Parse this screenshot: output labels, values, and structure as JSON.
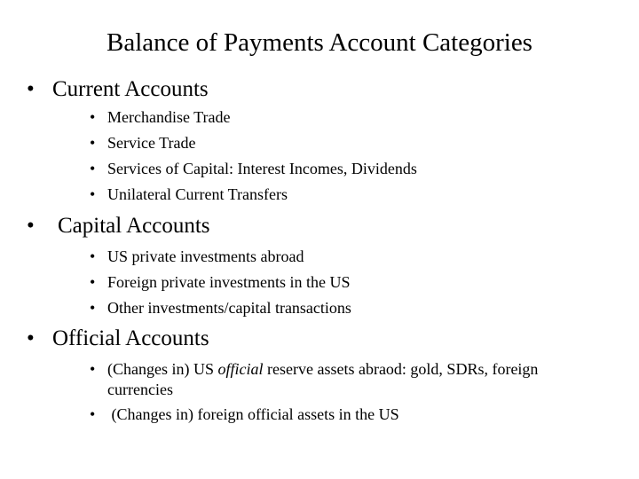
{
  "slide": {
    "title": "Balance of Payments Account Categories",
    "bullet_char": "•",
    "sections": [
      {
        "heading": "Current Accounts",
        "items": [
          "Merchandise Trade",
          "Service Trade",
          "Services of Capital: Interest Incomes, Dividends",
          "Unilateral Current Transfers"
        ]
      },
      {
        "heading": "Capital Accounts",
        "items": [
          "US private investments abroad",
          "Foreign private investments in the US",
          "Other investments/capital transactions"
        ]
      },
      {
        "heading": "Official Accounts",
        "items": [
          {
            "prefix": "(Changes in) US ",
            "emphasis": "official",
            "suffix": " reserve assets abraod: gold, SDRs, foreign",
            "continuation": "currencies"
          },
          " (Changes in) foreign official assets in the US"
        ]
      }
    ]
  }
}
